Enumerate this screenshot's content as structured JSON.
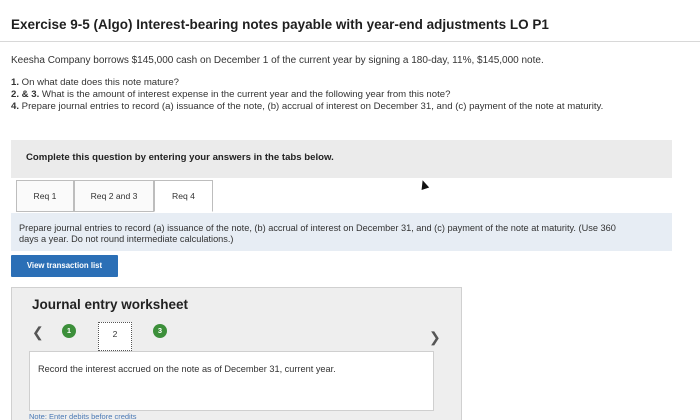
{
  "header": {
    "title": "Exercise 9-5 (Algo) Interest-bearing notes payable with year-end adjustments LO P1"
  },
  "problem": {
    "statement": "Keesha Company borrows $145,000 cash on December 1 of the current year by signing a 180-day, 11%, $145,000 note.",
    "questions": [
      {
        "num": "1.",
        "text": " On what date does this note mature?"
      },
      {
        "num": "2. & 3.",
        "text": " What is the amount of interest expense in the current year and the following year from this note?"
      },
      {
        "num": "4.",
        "text": " Prepare journal entries to record (a) issuance of the note, (b) accrual of interest on December 31, and (c) payment of the note at maturity."
      }
    ]
  },
  "panel": {
    "instruction": "Complete this question by entering your answers in the tabs below."
  },
  "tabs": [
    {
      "label": "Req 1"
    },
    {
      "label": "Req 2 and 3"
    },
    {
      "label": "Req 4"
    }
  ],
  "req_instruction": "Prepare journal entries to record (a) issuance of the note, (b) accrual of interest on December 31, and (c) payment of the note at maturity. (Use 360 days a year. Do not round intermediate calculations.)",
  "buttons": {
    "view_transaction_list": "View transaction list"
  },
  "worksheet": {
    "title": "Journal entry worksheet",
    "steps": [
      "1",
      "2",
      "3"
    ],
    "current_step": "2",
    "prev_icon": "chevron-left-icon",
    "next_icon": "chevron-right-icon",
    "record_text": "Record the interest accrued on the note as of December 31, current year.",
    "note": "Note: Enter debits before credits"
  },
  "colors": {
    "accent_button": "#2b6fb6",
    "step_green": "#3c8f3a",
    "instruction_bg": "#e7edf4"
  }
}
